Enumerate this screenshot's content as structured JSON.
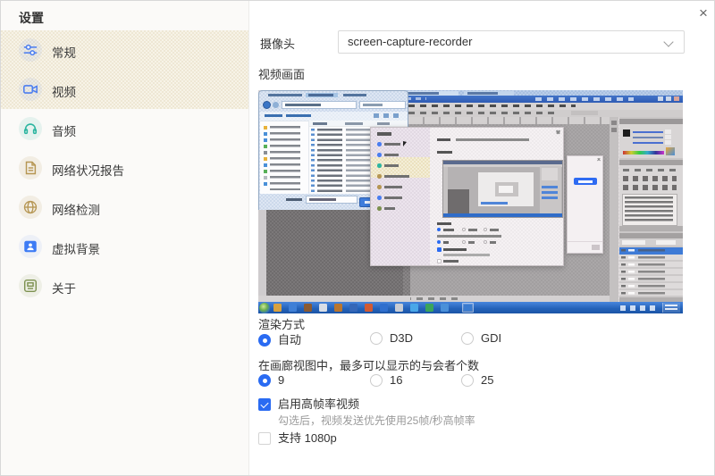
{
  "window": {
    "title": "设置",
    "close_glyph": "×"
  },
  "sidebar": {
    "items": [
      {
        "label": "常规",
        "icon": "sliders-icon",
        "highlighted": true
      },
      {
        "label": "视频",
        "icon": "video-camera-icon",
        "highlighted": true,
        "active": true
      },
      {
        "label": "音频",
        "icon": "headset-icon"
      },
      {
        "label": "网络状况报告",
        "icon": "report-document-icon"
      },
      {
        "label": "网络检测",
        "icon": "globe-icon"
      },
      {
        "label": "虚拟背景",
        "icon": "virtual-background-icon"
      },
      {
        "label": "关于",
        "icon": "about-icon"
      }
    ]
  },
  "main": {
    "camera": {
      "label": "摄像头",
      "value": "screen-capture-recorder"
    },
    "preview": {
      "label": "视频画面"
    },
    "render": {
      "label": "渲染方式",
      "options": [
        {
          "label": "自动",
          "selected": true
        },
        {
          "label": "D3D",
          "selected": false
        },
        {
          "label": "GDI",
          "selected": false
        }
      ]
    },
    "gallery": {
      "label": "在画廊视图中，最多可以显示的与会者个数",
      "options": [
        {
          "label": "9",
          "selected": true
        },
        {
          "label": "16",
          "selected": false
        },
        {
          "label": "25",
          "selected": false
        }
      ]
    },
    "high_fps": {
      "label": "启用高帧率视频",
      "checked": true,
      "hint": "勾选后，视频发送优先使用25帧/秒高帧率"
    },
    "p1080": {
      "label": "支持 1080p",
      "checked": false
    }
  },
  "colors": {
    "accent": "#2a6bf2",
    "icon_blue": "#4a7df0",
    "icon_teal": "#2cb5a0",
    "icon_gold": "#b69653",
    "icon_olive": "#7d9150"
  }
}
